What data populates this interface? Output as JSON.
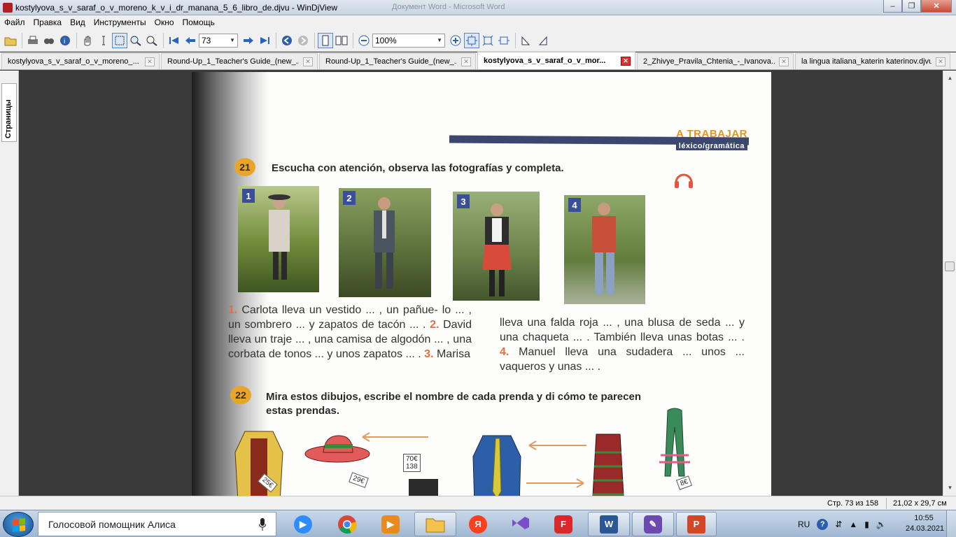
{
  "window": {
    "title": "kostylyova_s_v_saraf_o_v_moreno_k_v_i_dr_manana_5_6_libro_de.djvu - WinDjView",
    "background_title": "Документ Word - Microsoft Word",
    "minimize_glyph": "–",
    "restore_glyph": "❐",
    "close_glyph": "✕"
  },
  "menu": [
    "Файл",
    "Правка",
    "Вид",
    "Инструменты",
    "Окно",
    "Помощь"
  ],
  "toolbar": {
    "page_number": "73",
    "zoom": "100%"
  },
  "tabs": [
    {
      "label": "kostylyova_s_v_saraf_o_v_moreno_...",
      "active": false
    },
    {
      "label": "Round-Up_1_Teacher's Guide_(new_...",
      "active": false
    },
    {
      "label": "Round-Up_1_Teacher's Guide_(new_...",
      "active": false
    },
    {
      "label": "kostylyova_s_v_saraf_o_v_mor...",
      "active": true
    },
    {
      "label": "2_Zhivye_Pravila_Chtenia_-_Ivanova...",
      "active": false
    },
    {
      "label": "la lingua italiana_katerin katerinov.djvu",
      "active": false
    }
  ],
  "sidebar": {
    "pages_tab": "Страницы"
  },
  "page": {
    "section_title": "A TRABAJAR",
    "section_subtitle": "léxico/gramática",
    "ex21": {
      "number": "21",
      "instruction": "Escucha con atención, observa las fotografías y completa.",
      "photos": [
        "1",
        "2",
        "3",
        "4"
      ]
    },
    "text_left": {
      "n1": "1.",
      "p1": " Carlota lleva un vestido ... , un pañue- lo ... , un sombrero ... y zapatos de tacón ... . ",
      "n2": "2.",
      "p2": " David lleva un traje ... , una camisa de algodón ... , una corbata de tonos ... y unos zapatos ... . ",
      "n3": "3.",
      "p3": " Marisa"
    },
    "text_right": {
      "p1": "lleva una falda roja ... , una blusa de seda ... y una chaqueta ... . También lleva unas botas ... . ",
      "n4": "4.",
      "p2": " Manuel lleva una sudadera ... unos ... vaqueros y unas ... ."
    },
    "ex22": {
      "number": "22",
      "instruction": "Mira estos dibujos, escribe el nombre de cada prenda y di cómo te parecen estas prendas."
    },
    "tags": {
      "hat": "29€",
      "dress_tag": "25€",
      "shirt_top": "70€",
      "shirt_bottom": "138",
      "scarf": "8€"
    }
  },
  "status": {
    "page_info": "Стр. 73 из 158",
    "page_size": "21,02 x 29,7 см"
  },
  "taskbar": {
    "search_text": "Голосовой помощник Алиса",
    "language": "RU",
    "time": "10:55",
    "date": "24.03.2021"
  },
  "colors": {
    "accent_orange": "#e49420",
    "section_blue": "#3c4770",
    "number_red": "#e07040"
  }
}
